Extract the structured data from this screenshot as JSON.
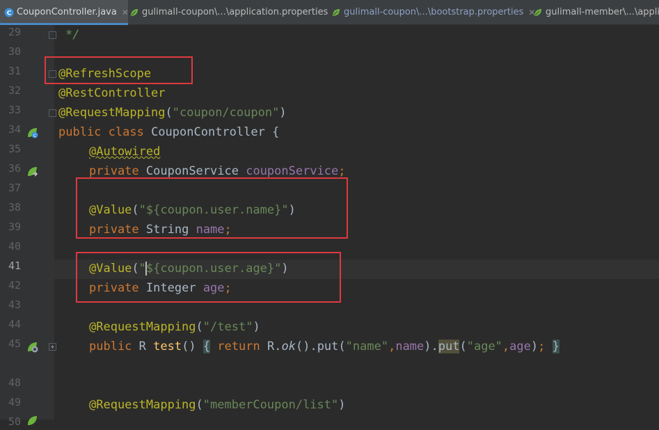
{
  "tabs": [
    {
      "label": "CouponController.java",
      "icon": "java-class-icon",
      "active": true,
      "closable": true
    },
    {
      "label": "gulimall-coupon\\...\\application.properties",
      "icon": "spring-leaf-icon",
      "active": false,
      "closable": true
    },
    {
      "label": "gulimall-coupon\\...\\bootstrap.properties",
      "icon": "spring-leaf-icon",
      "active": false,
      "closable": true
    },
    {
      "label": "gulimall-member\\...\\applicat",
      "icon": "spring-leaf-icon",
      "active": false,
      "closable": false
    }
  ],
  "line_numbers": [
    "29",
    "30",
    "31",
    "32",
    "33",
    "34",
    "35",
    "36",
    "37",
    "38",
    "39",
    "40",
    "41",
    "42",
    "43",
    "44",
    "45",
    "48",
    "49",
    "50"
  ],
  "current_line": "41",
  "code": {
    "l29": "*/",
    "l31": "@RefreshScope",
    "l32": "@RestController",
    "l33_ann": "@RequestMapping",
    "l33_str": "\"coupon/coupon\"",
    "l34_kw": "public class",
    "l34_name": "CouponController {",
    "l35": "@Autowired",
    "l36_kw": "private",
    "l36_type": "CouponService",
    "l36_field": "couponService",
    "l38_ann": "@Value",
    "l38_str": "\"${coupon.user.name}\"",
    "l39_kw": "private",
    "l39_type": "String",
    "l39_field": "name",
    "l41_ann": "@Value",
    "l41_str_a": "\"",
    "l41_str_b": "${coupon.user.age}\"",
    "l42_kw": "private",
    "l42_type": "Integer",
    "l42_field": "age",
    "l44_ann": "@RequestMapping",
    "l44_str": "\"/test\"",
    "l45_kw": "public",
    "l45_type": "R",
    "l45_fn": "test",
    "l45_return": "return",
    "l45_ok": "ok",
    "l45_put1": "put",
    "l45_s1": "\"name\"",
    "l45_f1": "name",
    "l45_put2": "put",
    "l45_s2": "\"age\"",
    "l45_f2": "age",
    "l50_ann": "@RequestMapping",
    "l50_str": "\"memberCoupon/list\""
  },
  "highlight_color": "#e0393e",
  "accent": "#4a88c7"
}
